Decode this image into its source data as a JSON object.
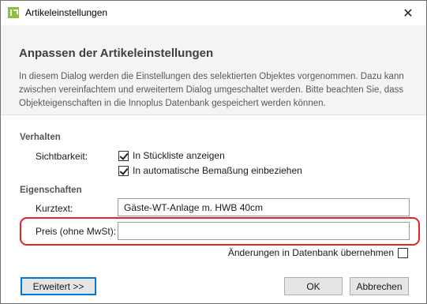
{
  "window": {
    "title": "Artikeleinstellungen",
    "close_symbol": "✕"
  },
  "header": {
    "title": "Anpassen der Artikeleinstellungen",
    "description": "In diesem Dialog werden die Einstellungen des selektierten Objektes vorgenommen. Dazu kann zwischen vereinfachtem und erweitertem Dialog umgeschaltet werden. Bitte beachten Sie, dass Objekteigenschaften in die Innoplus Datenbank gespeichert werden können."
  },
  "verhalten": {
    "section_label": "Verhalten",
    "sichtbarkeit_label": "Sichtbarkeit:",
    "checkbox_stueckliste": {
      "label": "In Stückliste anzeigen",
      "checked": true
    },
    "checkbox_bemassung": {
      "label": "In automatische Bemaßung einbeziehen",
      "checked": true
    }
  },
  "eigenschaften": {
    "section_label": "Eigenschaften",
    "kurztext_label": "Kurztext:",
    "kurztext_value": "Gäste-WT-Anlage m. HWB 40cm",
    "preis_label": "Preis (ohne MwSt):",
    "preis_value": ""
  },
  "db_option": {
    "label": "Änderungen in Datenbank übernehmen",
    "checked": false
  },
  "buttons": {
    "erweitert": "Erweitert >>",
    "ok": "OK",
    "abbrechen": "Abbrechen"
  },
  "colors": {
    "highlight": "#e8202a",
    "primary_border": "#0078d7",
    "header_bg": "#f4f4f4",
    "app_icon": "#8cbf3f"
  }
}
